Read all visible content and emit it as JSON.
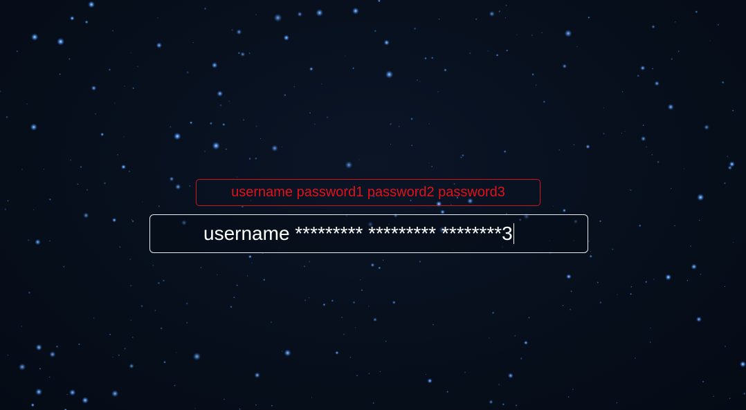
{
  "hint": {
    "text": "username password1 password2 password3",
    "color": "#e0121a"
  },
  "input": {
    "value": "username ********* ********* ********3",
    "text_color": "#ffffff",
    "border_color": "#e8edf3"
  },
  "background": {
    "base_color": "#060d18",
    "star_color": "#4a90e2",
    "description_icon": "starfield"
  }
}
